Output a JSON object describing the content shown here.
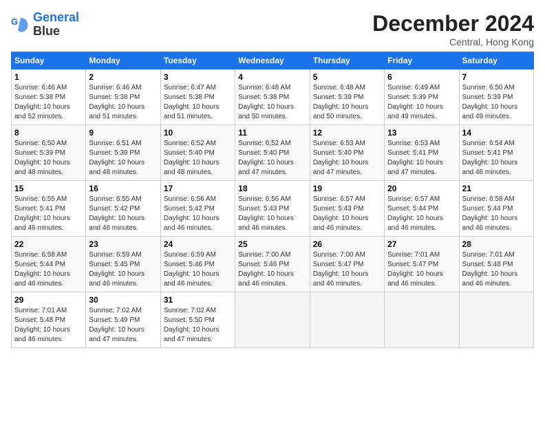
{
  "logo": {
    "line1": "General",
    "line2": "Blue"
  },
  "title": "December 2024",
  "subtitle": "Central, Hong Kong",
  "headers": [
    "Sunday",
    "Monday",
    "Tuesday",
    "Wednesday",
    "Thursday",
    "Friday",
    "Saturday"
  ],
  "weeks": [
    [
      {
        "day": "1",
        "sunrise": "Sunrise: 6:46 AM",
        "sunset": "Sunset: 5:38 PM",
        "daylight": "Daylight: 10 hours and 52 minutes."
      },
      {
        "day": "2",
        "sunrise": "Sunrise: 6:46 AM",
        "sunset": "Sunset: 5:38 PM",
        "daylight": "Daylight: 10 hours and 51 minutes."
      },
      {
        "day": "3",
        "sunrise": "Sunrise: 6:47 AM",
        "sunset": "Sunset: 5:38 PM",
        "daylight": "Daylight: 10 hours and 51 minutes."
      },
      {
        "day": "4",
        "sunrise": "Sunrise: 6:48 AM",
        "sunset": "Sunset: 5:38 PM",
        "daylight": "Daylight: 10 hours and 50 minutes."
      },
      {
        "day": "5",
        "sunrise": "Sunrise: 6:48 AM",
        "sunset": "Sunset: 5:39 PM",
        "daylight": "Daylight: 10 hours and 50 minutes."
      },
      {
        "day": "6",
        "sunrise": "Sunrise: 6:49 AM",
        "sunset": "Sunset: 5:39 PM",
        "daylight": "Daylight: 10 hours and 49 minutes."
      },
      {
        "day": "7",
        "sunrise": "Sunrise: 6:50 AM",
        "sunset": "Sunset: 5:39 PM",
        "daylight": "Daylight: 10 hours and 49 minutes."
      }
    ],
    [
      {
        "day": "8",
        "sunrise": "Sunrise: 6:50 AM",
        "sunset": "Sunset: 5:39 PM",
        "daylight": "Daylight: 10 hours and 48 minutes."
      },
      {
        "day": "9",
        "sunrise": "Sunrise: 6:51 AM",
        "sunset": "Sunset: 5:39 PM",
        "daylight": "Daylight: 10 hours and 48 minutes."
      },
      {
        "day": "10",
        "sunrise": "Sunrise: 6:52 AM",
        "sunset": "Sunset: 5:40 PM",
        "daylight": "Daylight: 10 hours and 48 minutes."
      },
      {
        "day": "11",
        "sunrise": "Sunrise: 6:52 AM",
        "sunset": "Sunset: 5:40 PM",
        "daylight": "Daylight: 10 hours and 47 minutes."
      },
      {
        "day": "12",
        "sunrise": "Sunrise: 6:53 AM",
        "sunset": "Sunset: 5:40 PM",
        "daylight": "Daylight: 10 hours and 47 minutes."
      },
      {
        "day": "13",
        "sunrise": "Sunrise: 6:53 AM",
        "sunset": "Sunset: 5:41 PM",
        "daylight": "Daylight: 10 hours and 47 minutes."
      },
      {
        "day": "14",
        "sunrise": "Sunrise: 6:54 AM",
        "sunset": "Sunset: 5:41 PM",
        "daylight": "Daylight: 10 hours and 46 minutes."
      }
    ],
    [
      {
        "day": "15",
        "sunrise": "Sunrise: 6:55 AM",
        "sunset": "Sunset: 5:41 PM",
        "daylight": "Daylight: 10 hours and 46 minutes."
      },
      {
        "day": "16",
        "sunrise": "Sunrise: 6:55 AM",
        "sunset": "Sunset: 5:42 PM",
        "daylight": "Daylight: 10 hours and 46 minutes."
      },
      {
        "day": "17",
        "sunrise": "Sunrise: 6:56 AM",
        "sunset": "Sunset: 5:42 PM",
        "daylight": "Daylight: 10 hours and 46 minutes."
      },
      {
        "day": "18",
        "sunrise": "Sunrise: 6:56 AM",
        "sunset": "Sunset: 5:43 PM",
        "daylight": "Daylight: 10 hours and 46 minutes."
      },
      {
        "day": "19",
        "sunrise": "Sunrise: 6:57 AM",
        "sunset": "Sunset: 5:43 PM",
        "daylight": "Daylight: 10 hours and 46 minutes."
      },
      {
        "day": "20",
        "sunrise": "Sunrise: 6:57 AM",
        "sunset": "Sunset: 5:44 PM",
        "daylight": "Daylight: 10 hours and 46 minutes."
      },
      {
        "day": "21",
        "sunrise": "Sunrise: 6:58 AM",
        "sunset": "Sunset: 5:44 PM",
        "daylight": "Daylight: 10 hours and 46 minutes."
      }
    ],
    [
      {
        "day": "22",
        "sunrise": "Sunrise: 6:58 AM",
        "sunset": "Sunset: 5:44 PM",
        "daylight": "Daylight: 10 hours and 46 minutes."
      },
      {
        "day": "23",
        "sunrise": "Sunrise: 6:59 AM",
        "sunset": "Sunset: 5:45 PM",
        "daylight": "Daylight: 10 hours and 46 minutes."
      },
      {
        "day": "24",
        "sunrise": "Sunrise: 6:59 AM",
        "sunset": "Sunset: 5:46 PM",
        "daylight": "Daylight: 10 hours and 46 minutes."
      },
      {
        "day": "25",
        "sunrise": "Sunrise: 7:00 AM",
        "sunset": "Sunset: 5:46 PM",
        "daylight": "Daylight: 10 hours and 46 minutes."
      },
      {
        "day": "26",
        "sunrise": "Sunrise: 7:00 AM",
        "sunset": "Sunset: 5:47 PM",
        "daylight": "Daylight: 10 hours and 46 minutes."
      },
      {
        "day": "27",
        "sunrise": "Sunrise: 7:01 AM",
        "sunset": "Sunset: 5:47 PM",
        "daylight": "Daylight: 10 hours and 46 minutes."
      },
      {
        "day": "28",
        "sunrise": "Sunrise: 7:01 AM",
        "sunset": "Sunset: 5:48 PM",
        "daylight": "Daylight: 10 hours and 46 minutes."
      }
    ],
    [
      {
        "day": "29",
        "sunrise": "Sunrise: 7:01 AM",
        "sunset": "Sunset: 5:48 PM",
        "daylight": "Daylight: 10 hours and 46 minutes."
      },
      {
        "day": "30",
        "sunrise": "Sunrise: 7:02 AM",
        "sunset": "Sunset: 5:49 PM",
        "daylight": "Daylight: 10 hours and 47 minutes."
      },
      {
        "day": "31",
        "sunrise": "Sunrise: 7:02 AM",
        "sunset": "Sunset: 5:50 PM",
        "daylight": "Daylight: 10 hours and 47 minutes."
      },
      null,
      null,
      null,
      null
    ]
  ]
}
